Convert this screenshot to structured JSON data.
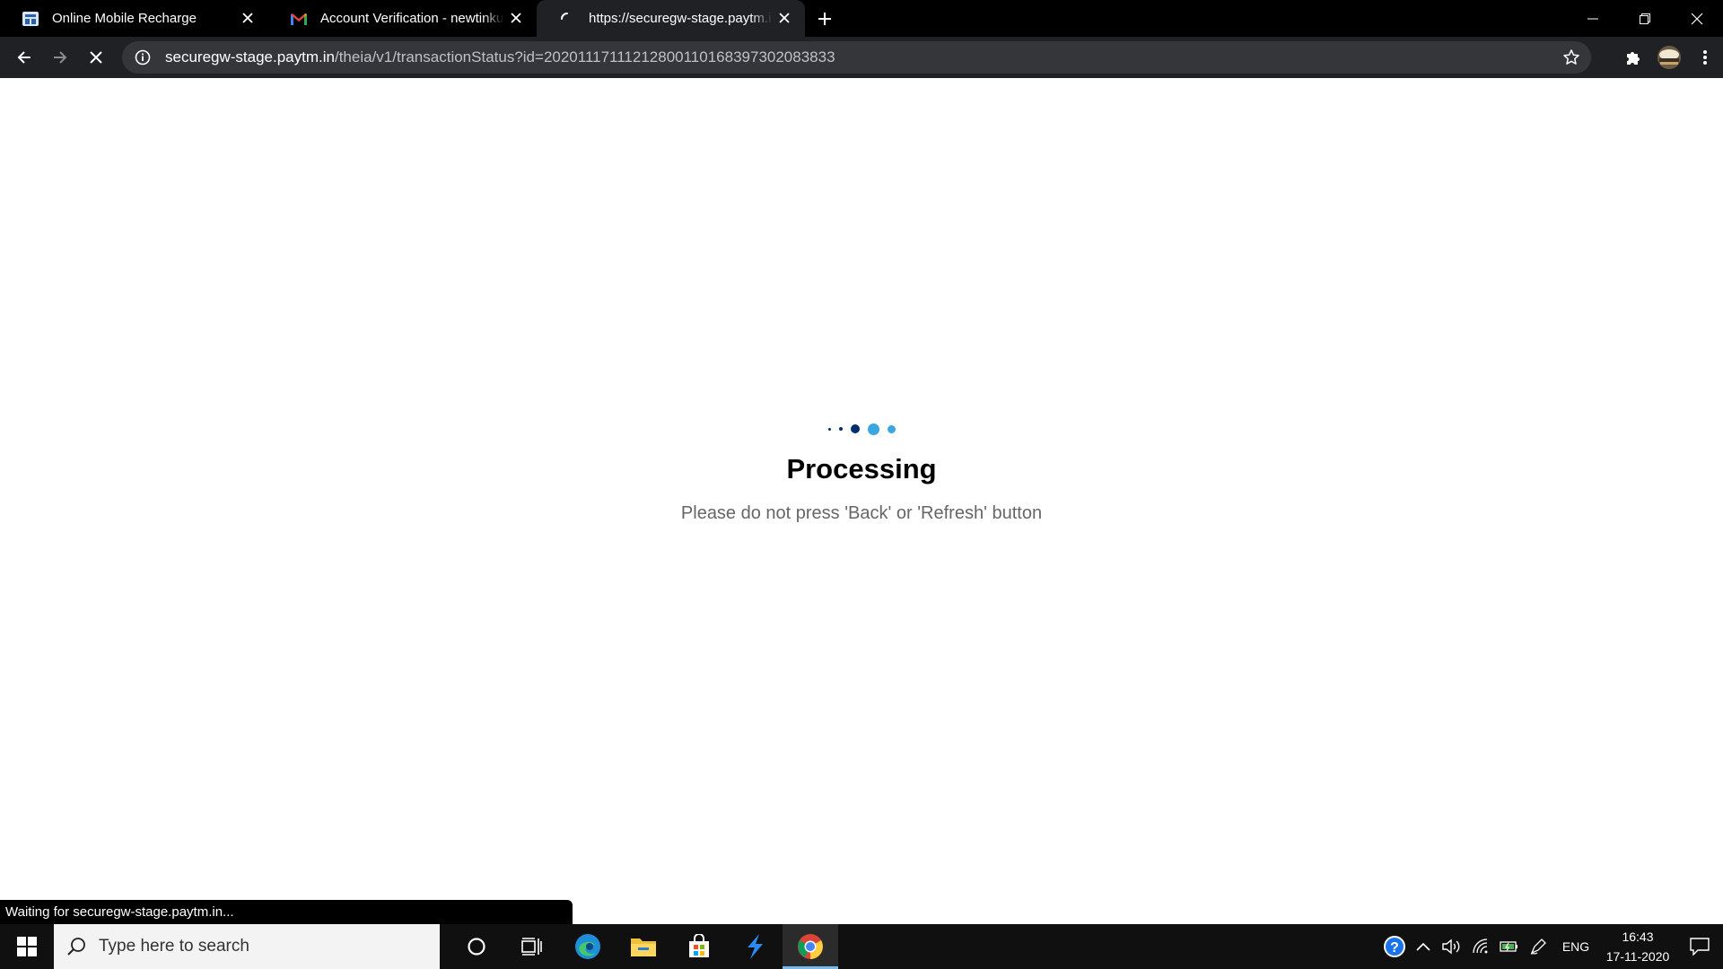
{
  "browser": {
    "tabs": [
      {
        "title": "Online Mobile Recharge",
        "icon": "site-favicon-icon",
        "active": false
      },
      {
        "title": "Account Verification - newtinkumar",
        "icon": "gmail-icon",
        "active": false
      },
      {
        "title": "https://securegw-stage.paytm.in/",
        "icon": "loading-spinner-icon",
        "active": true
      }
    ],
    "url_host": "securegw-stage.paytm.in",
    "url_path": "/theia/v1/transactionStatus?id=20201117111212800110168397302083833"
  },
  "page": {
    "title": "Processing",
    "subtitle": "Please do not press 'Back' or 'Refresh' button",
    "loader_colors": [
      "#002e6e",
      "#002e6e",
      "#002e6e",
      "#3aa7e0",
      "#3aa7e0"
    ]
  },
  "status_bubble": "Waiting for securegw-stage.paytm.in...",
  "taskbar": {
    "search_placeholder": "Type here to search",
    "language": "ENG",
    "time": "16:43",
    "date": "17-11-2020"
  }
}
